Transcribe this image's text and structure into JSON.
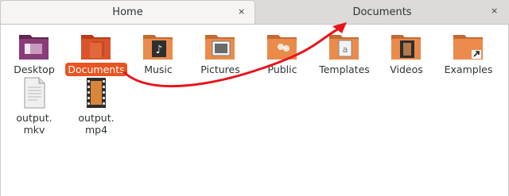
{
  "tabs": [
    {
      "label": "Home",
      "close": "×"
    },
    {
      "label": "Documents",
      "close": "×"
    }
  ],
  "items": [
    {
      "label": "Desktop",
      "icon": "desktop-folder-icon"
    },
    {
      "label": "Documents",
      "icon": "documents-folder-icon",
      "selected": true
    },
    {
      "label": "Music",
      "icon": "music-folder-icon"
    },
    {
      "label": "Pictures",
      "icon": "pictures-folder-icon"
    },
    {
      "label": "Public",
      "icon": "public-folder-icon"
    },
    {
      "label": "Templates",
      "icon": "templates-folder-icon"
    },
    {
      "label": "Videos",
      "icon": "videos-folder-icon"
    },
    {
      "label": "Examples",
      "icon": "examples-folder-icon"
    },
    {
      "label": "output.\nmkv",
      "line1": "output.",
      "line2": "mkv",
      "icon": "text-file-icon"
    },
    {
      "label": "output.\nmp4",
      "line1": "output.",
      "line2": "mp4",
      "icon": "video-file-icon"
    }
  ],
  "colors": {
    "accent": "#e95420",
    "folder": "#e07a3e",
    "arrow": "#e8141a"
  }
}
